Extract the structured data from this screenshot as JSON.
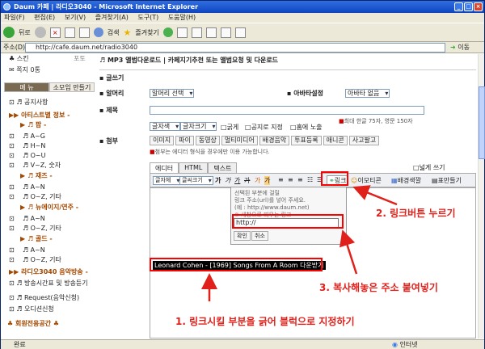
{
  "window": {
    "title": "Daum 카페 | 라디오3040 - Microsoft Internet Explorer"
  },
  "menu": [
    "파일(F)",
    "편집(E)",
    "보기(V)",
    "즐겨찾기(A)",
    "도구(T)",
    "도움말(H)"
  ],
  "toolbar": {
    "back": "뒤로",
    "search": "검색",
    "favorites": "즐겨찾기"
  },
  "address": {
    "label": "주소(D)",
    "url": "http://cafe.daum.net/radio3040",
    "go": "이동",
    "links": "연결"
  },
  "sidebar": {
    "top1": "스킨",
    "top1_tag": "포토",
    "top2": "쪽지 0통",
    "tab_menu": "메 뉴",
    "tab_small": "소모임 만들기",
    "notice": "공지사항",
    "artist_info": "아티스트별 정보 -",
    "pop": "팝 -",
    "az1": "A~G",
    "hn1": "H~N",
    "ou1": "O~U",
    "vz1": "V~Z, 숫자",
    "jazz": "재즈 -",
    "an1": "A~N",
    "oz1": "O~Z, 기타",
    "newage": "뉴에이지/연주 -",
    "an2": "A~N",
    "oz2": "O~Z, 기타",
    "gold": "골드 -",
    "an3": "A~N",
    "oz3": "O~Z, 기타",
    "radio": "라디오3040 음악방송 -",
    "schedule": "방송시간표 및 방송듣기",
    "request": "Request(음악신청)",
    "audition": "오디션신청",
    "members": "♣ 회원전용공간 ♣"
  },
  "content": {
    "breadcrumb": "♬ MP3 앨범다운로드 | 카페지기추천 또는 앨범요청 및 다운로드",
    "write": "글쓰기",
    "alarm_label": "알머리",
    "alarm_sel": "알머리 선택",
    "avatar_label": "아바타설정",
    "avatar_sel": "아바타 없음",
    "title_label": "제목",
    "title_hint": "최대 한글 75자, 영문 150자",
    "font_sel": "글자색",
    "size_sel": "글자크기",
    "bold": "굵게",
    "notice_chk": "공지로 지정",
    "home_chk": "홈에 노출",
    "attach_label": "첨부",
    "attach_btns": [
      "이미지",
      "파이",
      "동영상",
      "멀티미디어",
      "배경음악",
      "투표등록",
      "애니콘",
      "사고팔고"
    ],
    "attach_hint": "첨부는 에디터 형식을 경우에만 이용 가능합니다.",
    "editor_tabs": [
      "에디터",
      "HTML",
      "텍스트"
    ],
    "wide": "넓게 쓰기",
    "fmt_font": "글자체",
    "fmt_size": "글씨크기",
    "link_btn": "링크",
    "emoticon": "이모티콘",
    "bg": "배경색깔",
    "table": "표만들기",
    "popup_text": "선택된 부분에 걸릴\n링크 주소(url)를 넣어 주세요.\n(예 : http://www.daum.net)\n※ 새창으로 띄우는 링크",
    "popup_value": "http://",
    "popup_ok": "확인",
    "popup_cancel": "취소",
    "selected_text": "Leonard Cohen - [1969] Songs From A Room 다운받기"
  },
  "annotations": {
    "a1": "1. 링크시킬 부분을 긁어 블럭으로 지정하기",
    "a2": "2. 링크버튼 누르기",
    "a3": "3. 복사해놓은 주소 붙여넣기"
  },
  "status": {
    "left": "완료",
    "right": "인터넷"
  },
  "colors": {
    "accent": "#2f6ee0",
    "annotation": "#e0201a",
    "section": "#a44800"
  }
}
